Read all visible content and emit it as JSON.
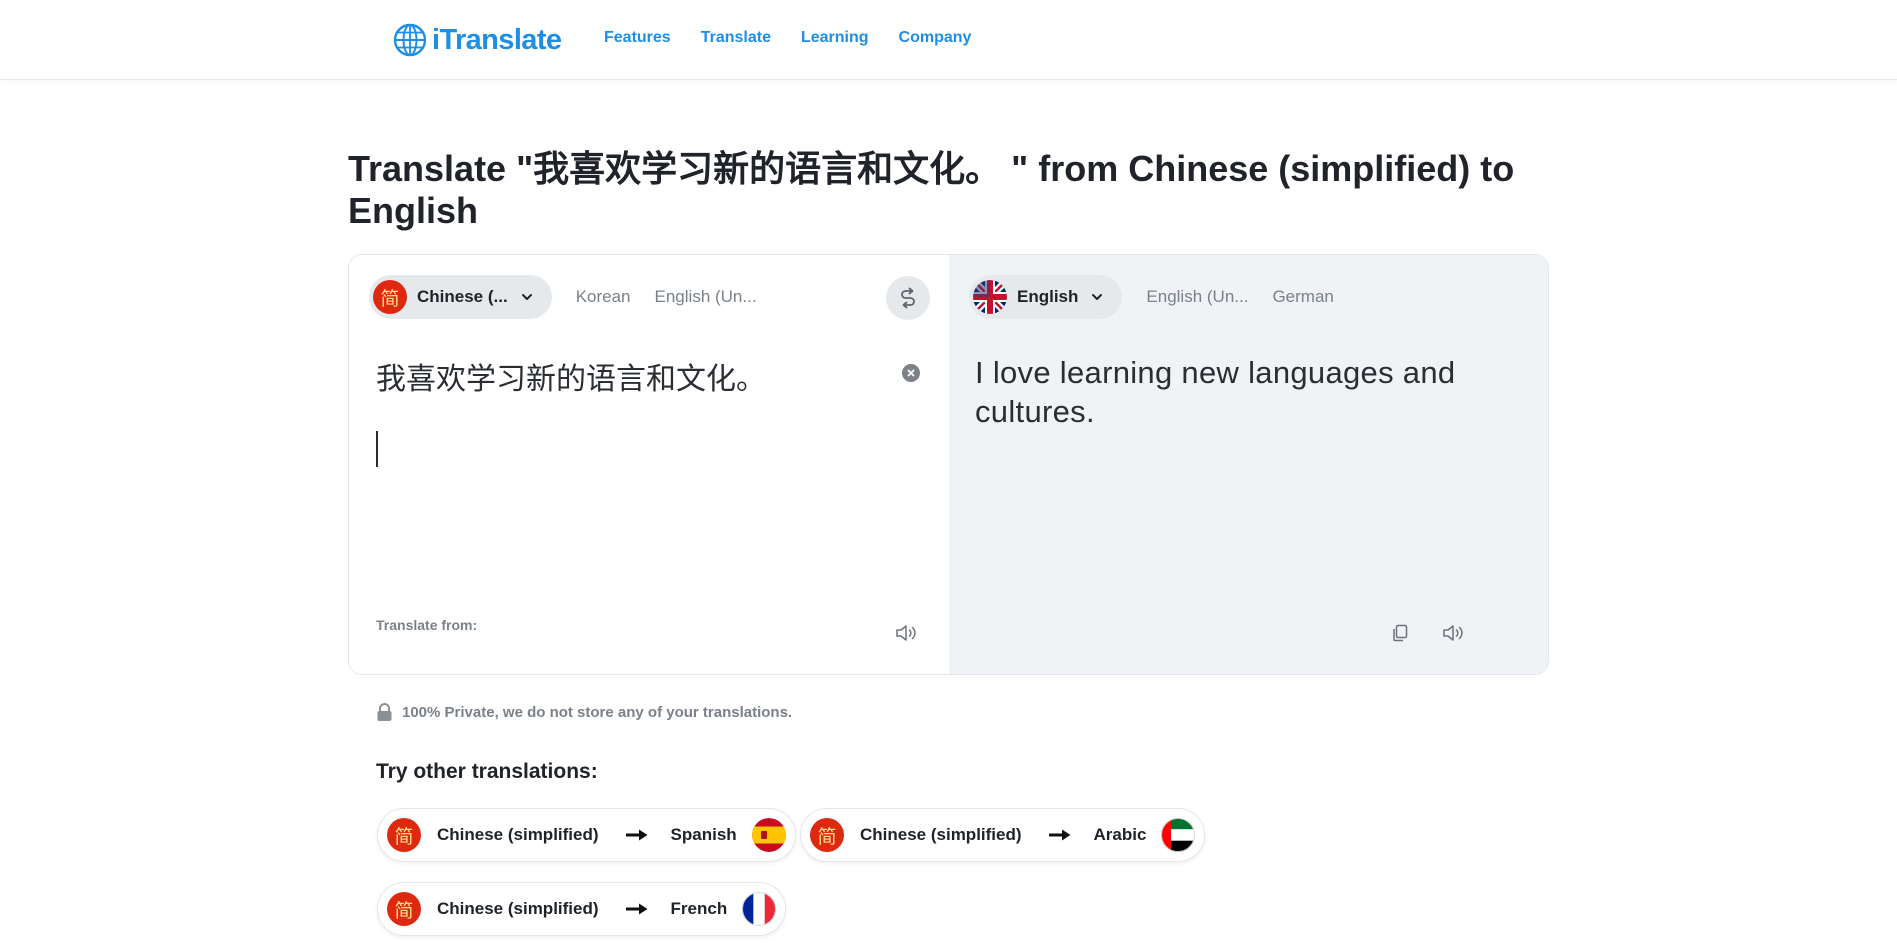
{
  "header": {
    "logo_text": "iTranslate",
    "nav": [
      "Features",
      "Translate",
      "Learning",
      "Company"
    ]
  },
  "page_title": "Translate \"我喜欢学习新的语言和文化。 \" from Chinese (simplified) to English",
  "source": {
    "selected_language": "Chinese (...",
    "flag_glyph": "简",
    "options": [
      "Korean",
      "English (Un..."
    ],
    "text": "我喜欢学习新的语言和文化。",
    "footer_label": "Translate from:"
  },
  "target": {
    "selected_language": "English",
    "options": [
      "English (Un...",
      "German"
    ],
    "text": "I love learning new languages and cultures."
  },
  "privacy_note": "100% Private, we do not store any of your translations.",
  "other_translations": {
    "heading": "Try other translations:",
    "pairs": [
      {
        "from": "Chinese (simplified)",
        "to": "Spanish",
        "flag_icon": "spain-flag-icon"
      },
      {
        "from": "Chinese (simplified)",
        "to": "Arabic",
        "flag_icon": "uae-flag-icon"
      },
      {
        "from": "Chinese (simplified)",
        "to": "French",
        "flag_icon": "france-flag-icon"
      }
    ]
  },
  "colors": {
    "brand_blue": "#1e8fe6",
    "chinese_red": "#de2910",
    "target_panel_bg": "#f0f3f6"
  }
}
